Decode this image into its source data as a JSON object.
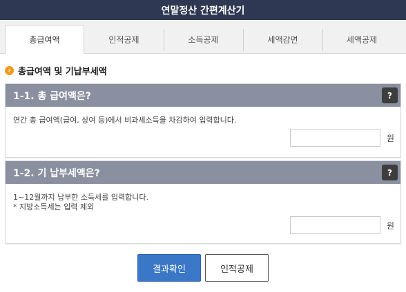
{
  "window": {
    "title": "연말정산 간편계산기"
  },
  "tabs": [
    {
      "label": "총급여액",
      "active": true
    },
    {
      "label": "인적공제",
      "active": false
    },
    {
      "label": "소득공제",
      "active": false
    },
    {
      "label": "세액감면",
      "active": false
    },
    {
      "label": "세액공제",
      "active": false
    }
  ],
  "section": {
    "icon": "orange-bullet-icon",
    "title": "총급여액 및 기납부세액"
  },
  "panels": [
    {
      "title": "1-1. 총 급여액은?",
      "help": "?",
      "desc": [
        "연간 총 급여액(급여, 상여 등)에서 비과세소득을 차감하여 입력합니다."
      ],
      "input_value": "",
      "unit": "원"
    },
    {
      "title": "1-2. 기 납부세액은?",
      "help": "?",
      "desc": [
        "1~12월까지 납부한 소득세를 입력합니다.",
        "* 지방소득세는 입력 제외"
      ],
      "input_value": "",
      "unit": "원"
    }
  ],
  "buttons": {
    "confirm": "결과확인",
    "next": "인적공제"
  },
  "colors": {
    "title_bar": "#2e3852",
    "panel_header": "#8b90a0",
    "primary_button": "#3a77c6",
    "bullet": "#f19a1d"
  }
}
